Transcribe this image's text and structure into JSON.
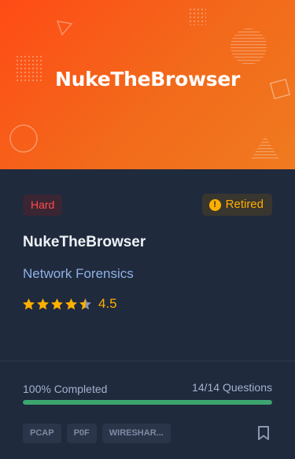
{
  "banner": {
    "title": "NukeTheBrowser"
  },
  "difficulty": "Hard",
  "status": {
    "icon": "exclamation-circle-icon",
    "label": "Retired"
  },
  "title": "NukeTheBrowser",
  "category": "Network Forensics",
  "rating": {
    "value": "4.5",
    "stars": 4.5,
    "max": 5
  },
  "progress": {
    "completed_label": "100% Completed",
    "questions_label": "14/14 Questions",
    "percent": 100
  },
  "tags": [
    "PCAP",
    "P0F",
    "WIRESHAR..."
  ],
  "actions": {
    "bookmark_icon": "bookmark-icon"
  },
  "colors": {
    "banner_start": "#ff4b16",
    "banner_end": "#f07a1f",
    "card_bg": "#1f2a3d",
    "hard": "#ff4c4c",
    "retired": "#ffaf00",
    "star": "#ffaf00",
    "progress": "#3ca56f",
    "category": "#8fb1e5"
  }
}
